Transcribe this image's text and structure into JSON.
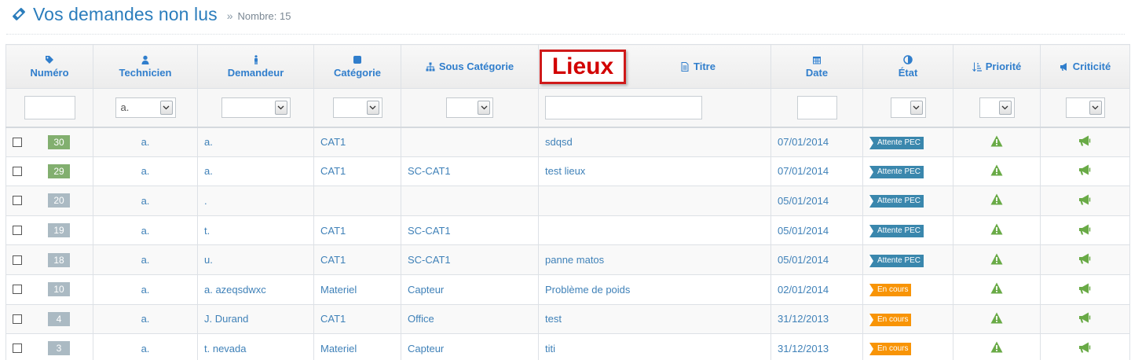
{
  "header": {
    "title": "Vos demandes non lus",
    "separator": "»",
    "count_label": "Nombre: 15"
  },
  "annotation": {
    "label": "Lieux"
  },
  "columns": [
    {
      "label": "Numéro",
      "icon": "tag-icon"
    },
    {
      "label": "Technicien",
      "icon": "user-icon"
    },
    {
      "label": "Demandeur",
      "icon": "male-icon"
    },
    {
      "label": "Catégorie",
      "icon": "square-icon"
    },
    {
      "label": "Sous Catégorie",
      "icon": "sitemap-icon"
    },
    {
      "label": "Titre",
      "icon": "file-text-icon"
    },
    {
      "label": "Date",
      "icon": "calendar-icon"
    },
    {
      "label": "État",
      "icon": "adjust-icon"
    },
    {
      "label": "Priorité",
      "icon": "sort-amount-icon"
    },
    {
      "label": "Criticité",
      "icon": "bullhorn-icon"
    }
  ],
  "filters": {
    "technicien_selected": "a."
  },
  "rows": [
    {
      "num": "30",
      "badge": "green",
      "technicien": "a.",
      "demandeur": "a.",
      "categorie": "CAT1",
      "sous_categorie": "",
      "titre": "sdqsd",
      "date": "07/01/2014",
      "etat": "Attente PEC",
      "etat_color": "blue"
    },
    {
      "num": "29",
      "badge": "green",
      "technicien": "a.",
      "demandeur": "a.",
      "categorie": "CAT1",
      "sous_categorie": "SC-CAT1",
      "titre": "test lieux",
      "date": "07/01/2014",
      "etat": "Attente PEC",
      "etat_color": "blue"
    },
    {
      "num": "20",
      "badge": "gray",
      "technicien": "a.",
      "demandeur": ".",
      "categorie": "",
      "sous_categorie": "",
      "titre": "",
      "date": "05/01/2014",
      "etat": "Attente PEC",
      "etat_color": "blue"
    },
    {
      "num": "19",
      "badge": "gray",
      "technicien": "a.",
      "demandeur": "t.",
      "categorie": "CAT1",
      "sous_categorie": "SC-CAT1",
      "titre": "",
      "date": "05/01/2014",
      "etat": "Attente PEC",
      "etat_color": "blue"
    },
    {
      "num": "18",
      "badge": "gray",
      "technicien": "a.",
      "demandeur": "u.",
      "categorie": "CAT1",
      "sous_categorie": "SC-CAT1",
      "titre": "panne matos",
      "date": "05/01/2014",
      "etat": "Attente PEC",
      "etat_color": "blue"
    },
    {
      "num": "10",
      "badge": "gray",
      "technicien": "a.",
      "demandeur": "a. azeqsdwxc",
      "categorie": "Materiel",
      "sous_categorie": "Capteur",
      "titre": "Problème de poids",
      "date": "02/01/2014",
      "etat": "En cours",
      "etat_color": "orange"
    },
    {
      "num": "4",
      "badge": "gray",
      "technicien": "a.",
      "demandeur": "J. Durand",
      "categorie": "CAT1",
      "sous_categorie": "Office",
      "titre": "test",
      "date": "31/12/2013",
      "etat": "En cours",
      "etat_color": "orange"
    },
    {
      "num": "3",
      "badge": "gray",
      "technicien": "a.",
      "demandeur": "t. nevada",
      "categorie": "Materiel",
      "sous_categorie": "Capteur",
      "titre": "titi",
      "date": "31/12/2013",
      "etat": "En cours",
      "etat_color": "orange"
    }
  ],
  "row_icons": {
    "priority": "warning-icon",
    "criticity": "bullhorn-icon"
  },
  "colors": {
    "link": "#3f81b8",
    "header_link": "#307ecc",
    "badge_new": "#82af6f",
    "badge_read": "#abbac3",
    "state_waiting": "#3a87ad",
    "state_in_progress": "#f89406",
    "icon_green": "#69aa46",
    "annotation_red": "#d20000"
  }
}
